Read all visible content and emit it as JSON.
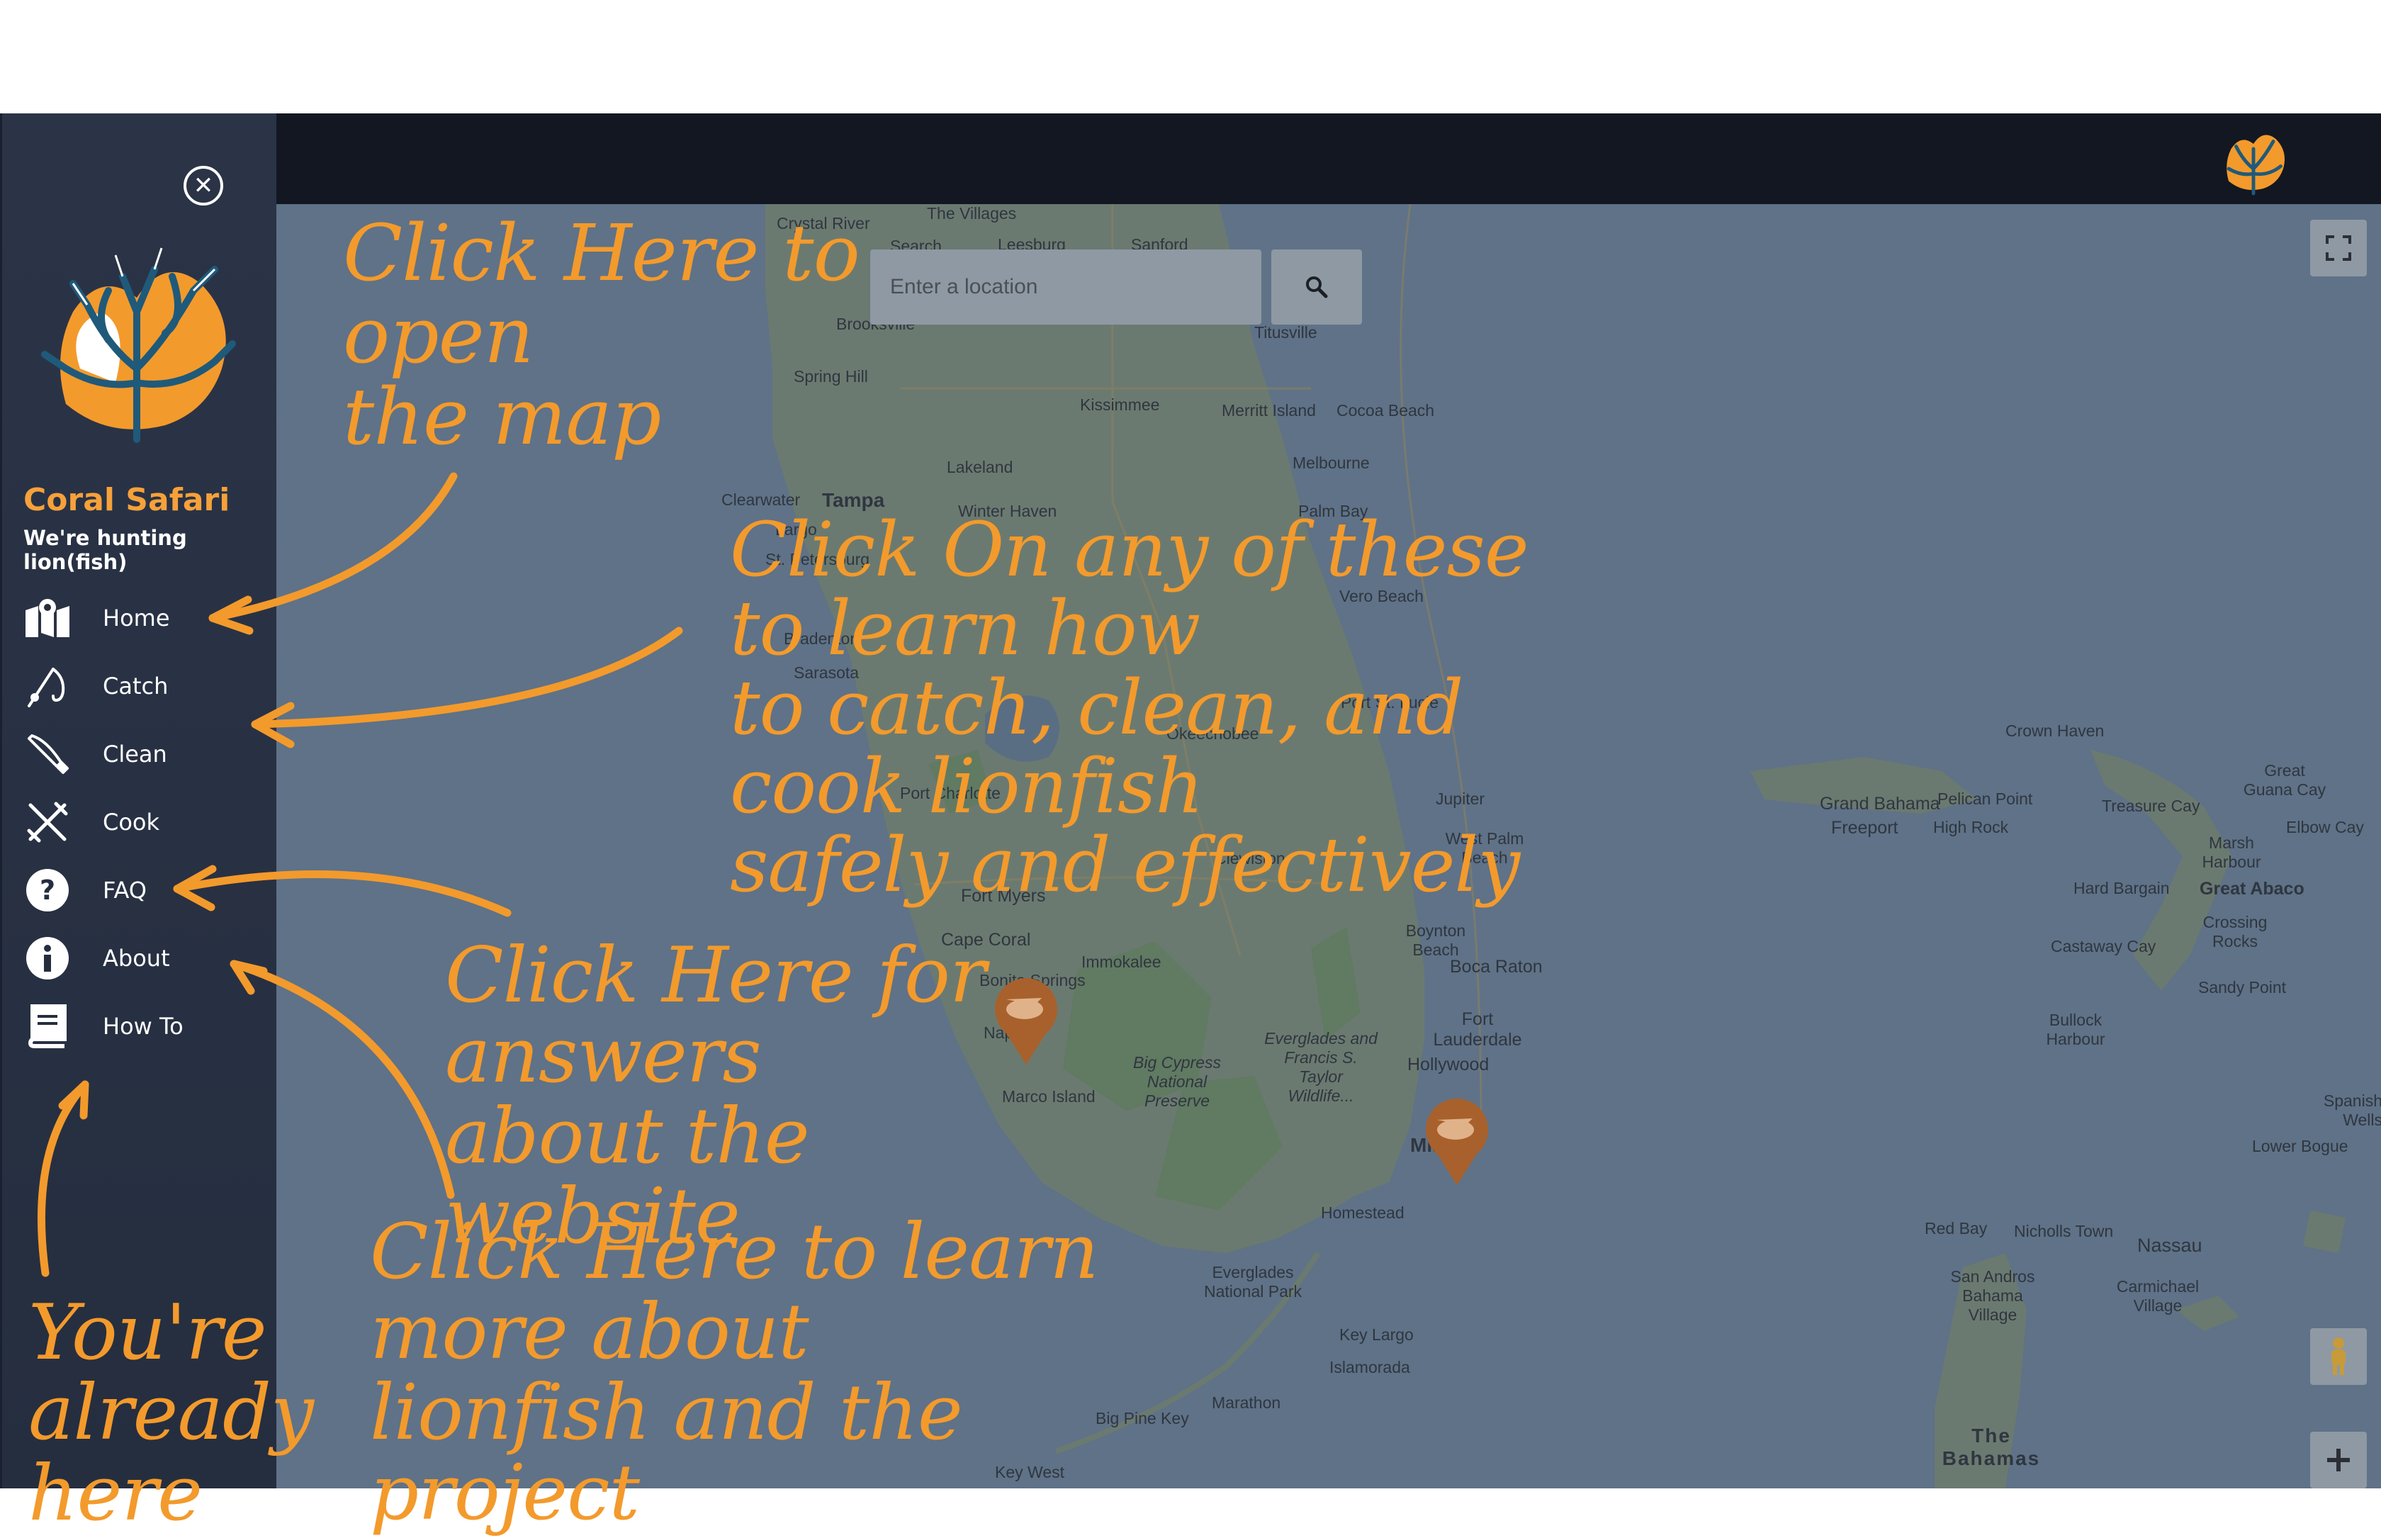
{
  "sidebar": {
    "brand_name": "Coral Safari",
    "tagline": "We're hunting lion(fish)",
    "nav": [
      {
        "label": "Home",
        "icon": "map-icon"
      },
      {
        "label": "Catch",
        "icon": "fishing-rod-icon"
      },
      {
        "label": "Clean",
        "icon": "knife-icon"
      },
      {
        "label": "Cook",
        "icon": "utensils-icon"
      },
      {
        "label": "FAQ",
        "icon": "question-circle-icon"
      },
      {
        "label": "About",
        "icon": "info-circle-icon"
      },
      {
        "label": "How To",
        "icon": "book-icon"
      }
    ]
  },
  "map": {
    "search_placeholder": "Enter a location",
    "places": [
      "Crystal River",
      "The Villages",
      "Leesburg",
      "Sanford",
      "Search",
      "Brooksville",
      "Spring Hill",
      "Titusville",
      "Kissimmee",
      "Merritt Island",
      "Cocoa Beach",
      "Lakeland",
      "Melbourne",
      "Clearwater",
      "Tampa",
      "Winter Haven",
      "Palm Bay",
      "Largo",
      "St. Petersburg",
      "Vero Beach",
      "Bradenton",
      "Sarasota",
      "Port St. Lucie",
      "Okeechobee",
      "Port Charlotte",
      "Jupiter",
      "West Palm Beach",
      "Clewiston",
      "Fort Myers",
      "Cape Coral",
      "Boynton Beach",
      "Boca Raton",
      "Bonita Springs",
      "Immokalee",
      "Fort Lauderdale",
      "Naples",
      "Big Cypress National Preserve",
      "Everglades and Francis S. Taylor Wildlife...",
      "Hollywood",
      "Marco Island",
      "Miami",
      "Homestead",
      "Everglades National Park",
      "Key Largo",
      "Islamorada",
      "Big Pine Key",
      "Marathon",
      "Key West",
      "Grand Bahama",
      "Freeport",
      "Pelican Point",
      "High Rock",
      "Crown Haven",
      "Treasure Cay",
      "Great Guana Cay",
      "Marsh Harbour",
      "Elbow Cay",
      "Hard Bargain",
      "Great Abaco",
      "Crossing Rocks",
      "Castaway Cay",
      "Sandy Point",
      "Bullock Harbour",
      "Spanish Wells",
      "Lower Bogue",
      "Red Bay",
      "Nicholls Town",
      "Nassau",
      "San Andros Bahama Village",
      "Carmichael Village",
      "The Bahamas"
    ]
  },
  "annotations": {
    "open_map": "Click Here to open\nthe map",
    "catch_clean_cook": "Click On any of these to learn how\nto catch, clean, and cook lionfish\nsafely and effectively",
    "faq": "Click Here for answers\nabout the website",
    "about": "Click Here to learn more about\nlionfish and the project",
    "how_to": "You're\nalready here"
  },
  "colors": {
    "accent": "#f39a2c",
    "brand": "#f6a13a",
    "sidebar_bg": "#252e3f",
    "topbar_bg": "#121722",
    "map_overlay": "#5f7287"
  }
}
